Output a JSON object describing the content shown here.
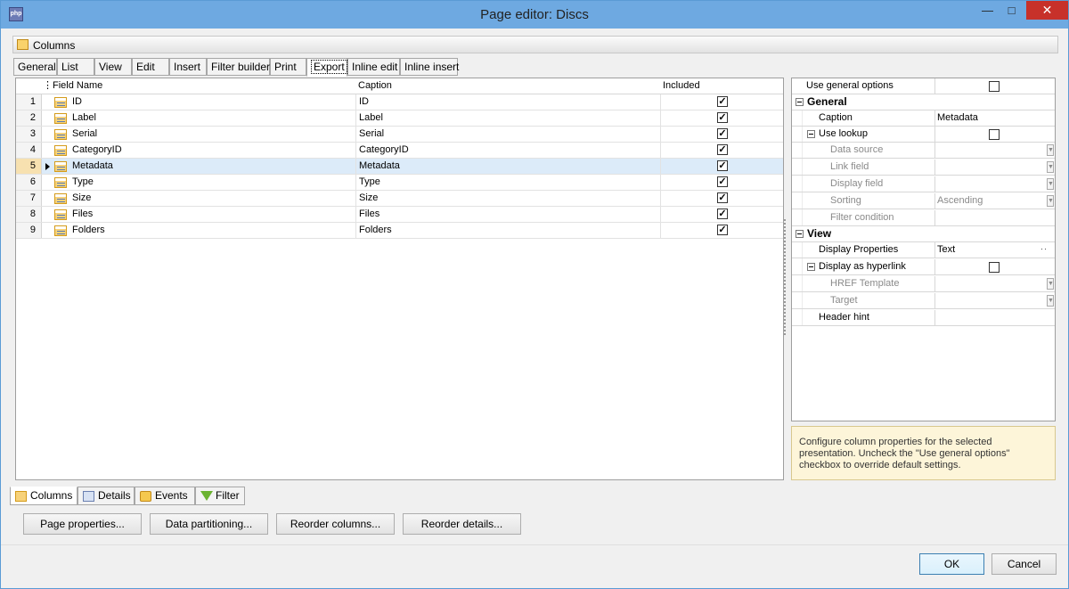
{
  "window": {
    "title": "Page editor: Discs",
    "app_icon": "php"
  },
  "header": {
    "label": "Columns"
  },
  "tabs": [
    "General",
    "List",
    "View",
    "Edit",
    "Insert",
    "Filter builder",
    "Print",
    "Export",
    "Inline edit",
    "Inline insert"
  ],
  "active_tab": "Export",
  "grid": {
    "columns": [
      "Field Name",
      "Caption",
      "Included"
    ],
    "rows": [
      {
        "n": "1",
        "field": "ID",
        "caption": "ID",
        "included": true
      },
      {
        "n": "2",
        "field": "Label",
        "caption": "Label",
        "included": true
      },
      {
        "n": "3",
        "field": "Serial",
        "caption": "Serial",
        "included": true
      },
      {
        "n": "4",
        "field": "CategoryID",
        "caption": "CategoryID",
        "included": true
      },
      {
        "n": "5",
        "field": "Metadata",
        "caption": "Metadata",
        "included": true,
        "selected": true
      },
      {
        "n": "6",
        "field": "Type",
        "caption": "Type",
        "included": true
      },
      {
        "n": "7",
        "field": "Size",
        "caption": "Size",
        "included": true
      },
      {
        "n": "8",
        "field": "Files",
        "caption": "Files",
        "included": true
      },
      {
        "n": "9",
        "field": "Folders",
        "caption": "Folders",
        "included": true
      }
    ]
  },
  "props": {
    "use_general": "Use general options",
    "general": "General",
    "caption_k": "Caption",
    "caption_v": "Metadata",
    "use_lookup": "Use lookup",
    "data_source": "Data source",
    "link_field": "Link field",
    "display_field": "Display field",
    "sorting_k": "Sorting",
    "sorting_v": "Ascending",
    "filter_condition": "Filter condition",
    "view": "View",
    "display_props_k": "Display Properties",
    "display_props_v": "Text",
    "display_hyperlink": "Display as hyperlink",
    "href_template": "HREF Template",
    "target": "Target",
    "header_hint": "Header hint"
  },
  "hint": "Configure column properties for the selected presentation. Uncheck the \"Use general options\" checkbox to override default settings.",
  "bottom_tabs": [
    "Columns",
    "Details",
    "Events",
    "Filter"
  ],
  "buttons": {
    "page_properties": "Page properties...",
    "data_partitioning": "Data partitioning...",
    "reorder_columns": "Reorder columns...",
    "reorder_details": "Reorder details...",
    "ok": "OK",
    "cancel": "Cancel"
  },
  "colors": {
    "title_bar": "#6ea9e1",
    "close_button": "#c7312a",
    "selected_row": "#dcebf9",
    "hint_bg": "#fdf5d9"
  }
}
